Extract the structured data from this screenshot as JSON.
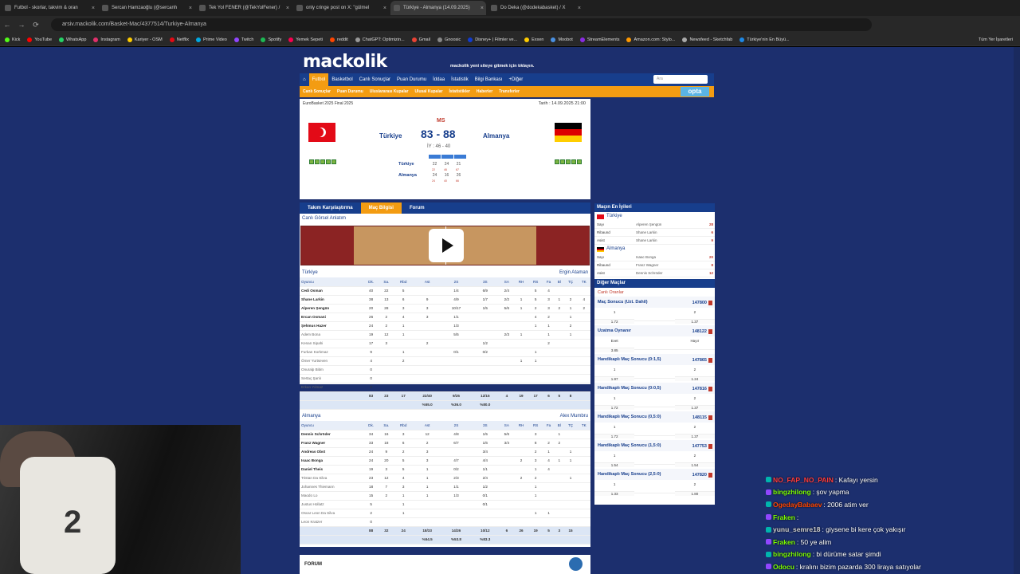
{
  "browser": {
    "tabs": [
      {
        "title": "Futbol - skorlar, takvim & oran"
      },
      {
        "title": "Sercan Hamzaoğlu (@sercanh"
      },
      {
        "title": "Tek Yol FENER (@TekYolFener) /"
      },
      {
        "title": "only cringe post on X: \"gülmel"
      },
      {
        "title": "Türkiye - Almanya (14.09.2025)"
      },
      {
        "title": "Do Deka (@dodekabasket) / X"
      }
    ],
    "url": "arsiv.mackolik.com/Basket-Mac/4377514/Turkiye-Almanya",
    "bookmarks": [
      "Kick",
      "YouTube",
      "WhatsApp",
      "Instagram",
      "Kariyer - OSM",
      "Netflix",
      "Prime Video",
      "Twitch",
      "Spotify",
      "Yemek Sepeti",
      "reddit",
      "ChatGPT: Optimizin...",
      "Gmail",
      "Gnoosic",
      "Disney+ | Filmler ve...",
      "Exxen",
      "Moobot",
      "StreamElements",
      "Amazon.com: Stylo...",
      "Newsfeed - Sketchfab",
      "Türkiye'nin En Büyü..."
    ],
    "all_bookmarks": "Tüm Yer İşaretleri"
  },
  "site": {
    "logo": "mackolik",
    "logo_note": "mackolik yeni siteye gitmek için tıklayın.",
    "nav": [
      "Futbol",
      "Basketbol",
      "Canlı Sonuçlar",
      "Puan Durumu",
      "İddaa",
      "İstatistik",
      "Bilgi Bankası",
      "+Diğer"
    ],
    "search_placeholder": "Ara",
    "subnav": [
      "Canlı Sonuçlar",
      "Puan Durumu",
      "Uluslararası Kupalar",
      "Ulusal Kupalar",
      "İstatistikler",
      "Haberler",
      "Transferler"
    ],
    "opta": "opta"
  },
  "match": {
    "competition": "EuroBasket 2025 Final 2025",
    "date": "Tarih : 14.09.2025 21:00",
    "status": "MS",
    "home": "Türkiye",
    "away": "Almanya",
    "score": "83 - 88",
    "halftime": "İY : 46 - 40",
    "quarters": {
      "home": {
        "name": "Türkiye",
        "q": [
          "22",
          "24",
          "21"
        ],
        "sub": [
          "22",
          "46",
          "67"
        ]
      },
      "away": {
        "name": "Almanya",
        "q": [
          "24",
          "16",
          "26"
        ],
        "sub": [
          "24",
          "40",
          "66"
        ]
      }
    }
  },
  "tabs": [
    "Takım Karşılaştırma",
    "Maç Bilgisi",
    "Forum"
  ],
  "live_label": "Canlı Görsel Anlatım",
  "columns": [
    "Oyuncu",
    "Dk.",
    "Sa.",
    "Rbd",
    "Ast",
    "2S",
    "3S",
    "SA",
    "RH",
    "RS",
    "Fa",
    "Bl",
    "TÇ",
    "TK"
  ],
  "home_box": {
    "team": "Türkiye",
    "coach": "Ergin Ataman",
    "rows": [
      [
        "Cedi Osman",
        "40",
        "22",
        "5",
        "",
        "1/4",
        "6/9",
        "2/4",
        "",
        "5",
        "4",
        "",
        "",
        ""
      ],
      [
        "Shane Larkin",
        "38",
        "13",
        "6",
        "9",
        "4/9",
        "1/7",
        "2/2",
        "1",
        "5",
        "3",
        "1",
        "2",
        "4"
      ],
      [
        "Alperen Şengün",
        "20",
        "28",
        "3",
        "3",
        "10/17",
        "1/5",
        "5/6",
        "1",
        "2",
        "3",
        "2",
        "1",
        "2"
      ],
      [
        "Ercan Osmani",
        "26",
        "2",
        "4",
        "3",
        "1/1",
        "",
        "",
        "",
        "4",
        "2",
        "",
        "1",
        ""
      ],
      [
        "Şehmus Hazer",
        "24",
        "2",
        "1",
        "",
        "1/3",
        "",
        "",
        "",
        "1",
        "1",
        "",
        "2",
        ""
      ],
      [
        "Adem Bona",
        "19",
        "12",
        "1",
        "",
        "5/5",
        "",
        "2/3",
        "1",
        "",
        "1",
        "",
        "1",
        ""
      ],
      [
        "Kenan Sipahi",
        "17",
        "3",
        "",
        "2",
        "",
        "1/2",
        "",
        "",
        "",
        "2",
        "",
        "",
        ""
      ],
      [
        "Furkan Korkmaz",
        "9",
        "",
        "1",
        "",
        "0/1",
        "0/2",
        "",
        "",
        "1",
        "",
        "",
        "",
        ""
      ],
      [
        "Ömer Yurtseven",
        "4",
        "",
        "2",
        "",
        "",
        "",
        "",
        "1",
        "1",
        "",
        "",
        "",
        ""
      ],
      [
        "Onuralp Bitim",
        "0",
        "",
        "",
        "",
        "",
        "",
        "",
        "",
        "",
        "",
        "",
        "",
        ""
      ],
      [
        "Sertaç Şanlı",
        "0",
        "",
        "",
        "",
        "",
        "",
        "",
        "",
        "",
        "",
        "",
        "",
        ""
      ],
      [
        "Erkan Yılmaz",
        "0",
        "",
        "",
        "",
        "",
        "",
        "",
        "",
        "",
        "",
        "",
        "",
        ""
      ]
    ],
    "total": [
      "",
      "83",
      "23",
      "17",
      "22/40",
      "9/25",
      "12/15",
      "4",
      "19",
      "17",
      "6",
      "5",
      "8"
    ],
    "pct": [
      "",
      "",
      "",
      "",
      "%55.0",
      "%36.0",
      "%80.0",
      "",
      "",
      "",
      "",
      "",
      ""
    ]
  },
  "away_box": {
    "team": "Almanya",
    "coach": "Alex Mumbru",
    "rows": [
      [
        "Dennis Schröder",
        "34",
        "16",
        "3",
        "12",
        "4/8",
        "1/5",
        "5/6",
        "",
        "3",
        "",
        "1",
        "",
        ""
      ],
      [
        "Franz Wagner",
        "33",
        "18",
        "6",
        "2",
        "6/7",
        "1/6",
        "3/4",
        "",
        "8",
        "2",
        "2",
        "",
        ""
      ],
      [
        "Andreas Obst",
        "24",
        "9",
        "2",
        "3",
        "",
        "3/4",
        "",
        "",
        "2",
        "1",
        "",
        "1",
        ""
      ],
      [
        "Isaac Bonga",
        "24",
        "20",
        "5",
        "3",
        "4/7",
        "4/4",
        "",
        "2",
        "3",
        "4",
        "1",
        "1",
        ""
      ],
      [
        "Daniel Theis",
        "19",
        "3",
        "5",
        "1",
        "0/2",
        "1/1",
        "",
        "",
        "1",
        "4",
        "",
        "",
        ""
      ],
      [
        "Tristan Da Silva",
        "23",
        "12",
        "4",
        "1",
        "2/3",
        "2/4",
        "",
        "2",
        "2",
        "",
        "",
        "1",
        ""
      ],
      [
        "Johannes Thiemann",
        "18",
        "7",
        "3",
        "1",
        "1/1",
        "1/2",
        "",
        "",
        "1",
        "",
        "",
        "",
        ""
      ],
      [
        "Maodo Lo",
        "15",
        "2",
        "1",
        "1",
        "1/3",
        "0/1",
        "",
        "",
        "1",
        "",
        "",
        "",
        ""
      ],
      [
        "Justus Hollatz",
        "5",
        "",
        "1",
        "",
        "",
        "0/1",
        "",
        "",
        "",
        "",
        "",
        "",
        ""
      ],
      [
        "Oscar Leon Da Silva",
        "2",
        "",
        "1",
        "",
        "",
        "",
        "",
        "",
        "1",
        "1",
        "",
        "",
        ""
      ],
      [
        "Leon Kratzer",
        "0",
        "",
        "",
        "",
        "",
        "",
        "",
        "",
        "",
        "",
        "",
        "",
        ""
      ]
    ],
    "total": [
      "",
      "88",
      "32",
      "24",
      "18/33",
      "14/26",
      "10/12",
      "6",
      "26",
      "19",
      "5",
      "3",
      "15"
    ],
    "pct": [
      "",
      "",
      "",
      "",
      "%54.5",
      "%53.8",
      "%83.3",
      "",
      "",
      "",
      "",
      "",
      ""
    ]
  },
  "best": {
    "title": "Maçın En İyileri",
    "home": {
      "team": "Türkiye",
      "rows": [
        [
          "Sayı",
          "Alperen Şengün",
          "28"
        ],
        [
          "Ribaund",
          "Shane Larkin",
          "6"
        ],
        [
          "Asist",
          "Shane Larkin",
          "9"
        ]
      ]
    },
    "away": {
      "team": "Almanya",
      "rows": [
        [
          "Sayı",
          "Isaac Bonga",
          "20"
        ],
        [
          "Ribaund",
          "Franz Wagner",
          "8"
        ],
        [
          "Asist",
          "Dennis Schröder",
          "12"
        ]
      ]
    }
  },
  "other": {
    "title": "Diğer Maçlar",
    "live_odds": "Canlı Oranlar",
    "markets": [
      {
        "name": "Maç Sonucu (Uzt. Dahil)",
        "code": "147800",
        "h": [
          "1",
          "",
          "2"
        ],
        "v": [
          "1.72",
          "",
          "1.37"
        ]
      },
      {
        "name": "Uzatma Oynanır",
        "code": "148122",
        "h": [
          "Evet",
          "",
          "Hayır"
        ],
        "v": [
          "3.85",
          "",
          ""
        ]
      },
      {
        "name": "Handikaplı Maç Sonucu (0:1,5)",
        "code": "147865",
        "h": [
          "1",
          "",
          "2"
        ],
        "v": [
          "1.97",
          "",
          "1.24"
        ]
      },
      {
        "name": "Handikaplı Maç Sonucu (0:0,5)",
        "code": "147816",
        "h": [
          "1",
          "",
          "2"
        ],
        "v": [
          "1.72",
          "",
          "1.37"
        ]
      },
      {
        "name": "Handikaplı Maç Sonucu (0,5:0)",
        "code": "148115",
        "h": [
          "1",
          "",
          "2"
        ],
        "v": [
          "1.72",
          "",
          "1.37"
        ]
      },
      {
        "name": "Handikaplı Maç Sonucu (1,5:0)",
        "code": "147753",
        "h": [
          "1",
          "",
          "2"
        ],
        "v": [
          "1.54",
          "",
          "1.54"
        ]
      },
      {
        "name": "Handikaplı Maç Sonucu (2,5:0)",
        "code": "147820",
        "h": [
          "1",
          "",
          "2"
        ],
        "v": [
          "1.33",
          "",
          "1.80"
        ]
      }
    ]
  },
  "forum": "FORUM",
  "chat": [
    {
      "user": "NO_FAP_NO_PAIN",
      "msg": ": Kafayı yersin",
      "color": "#ff3b3b"
    },
    {
      "user": "bingzhilong",
      "msg": ": şov yapma",
      "color": "#7cfc00"
    },
    {
      "user": "OgedayBabaev",
      "msg": ": 2006 atim ver",
      "color": "#ff4500"
    },
    {
      "user": "Fraken",
      "msg": ":",
      "color": "#7cfc00"
    },
    {
      "user": "yunu_semre18",
      "msg": ": giysene bi kere çok yakışır",
      "color": "#cfcfcf"
    },
    {
      "user": "Fraken",
      "msg": ": 50 ye alim",
      "color": "#7cfc00"
    },
    {
      "user": "bingzhilong",
      "msg": ": bi dürüme satar şimdi",
      "color": "#7cfc00"
    },
    {
      "user": "Odocu",
      "msg": ": kralını bizim pazarda 300 liraya satıyolar",
      "color": "#7cfc00"
    }
  ]
}
